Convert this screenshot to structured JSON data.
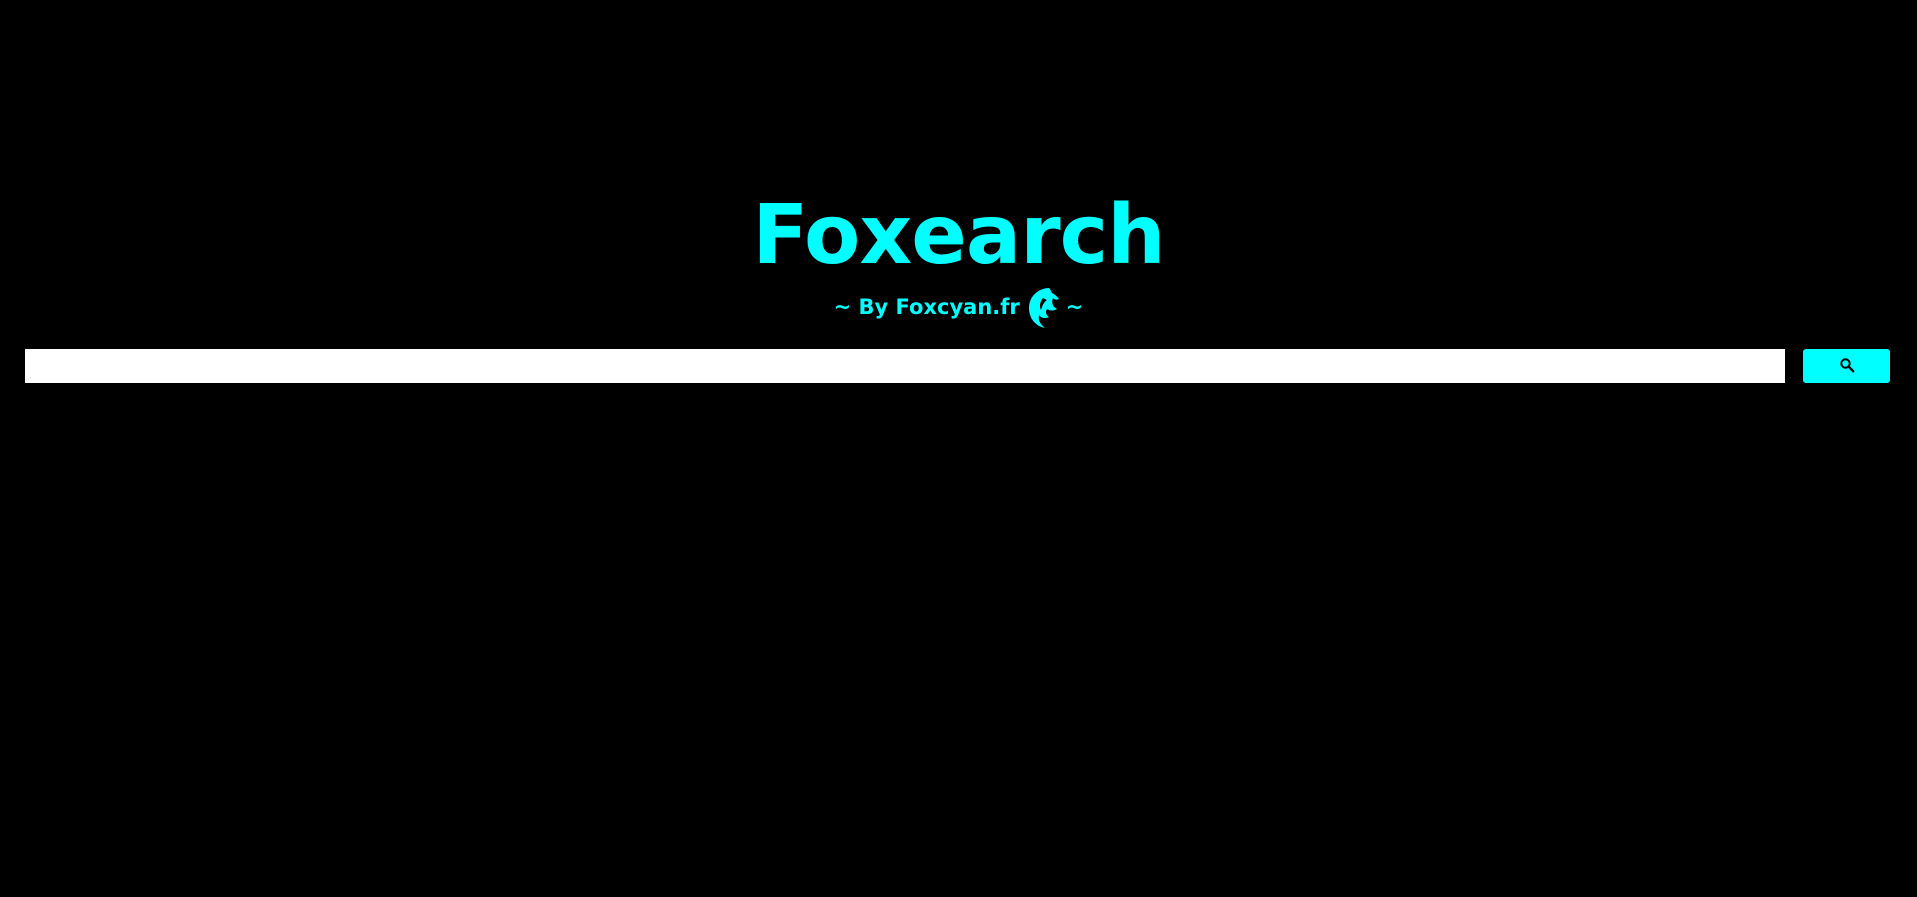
{
  "brand": {
    "title": "Foxearch",
    "subtitle_prefix": "~ By Foxcyan.fr",
    "subtitle_suffix": "~",
    "logo_icon": "fox-head-icon"
  },
  "search": {
    "value": "",
    "placeholder": "",
    "button_icon": "search-icon"
  },
  "colors": {
    "background": "#000000",
    "accent": "#00ffff",
    "input_background": "#ffffff"
  }
}
